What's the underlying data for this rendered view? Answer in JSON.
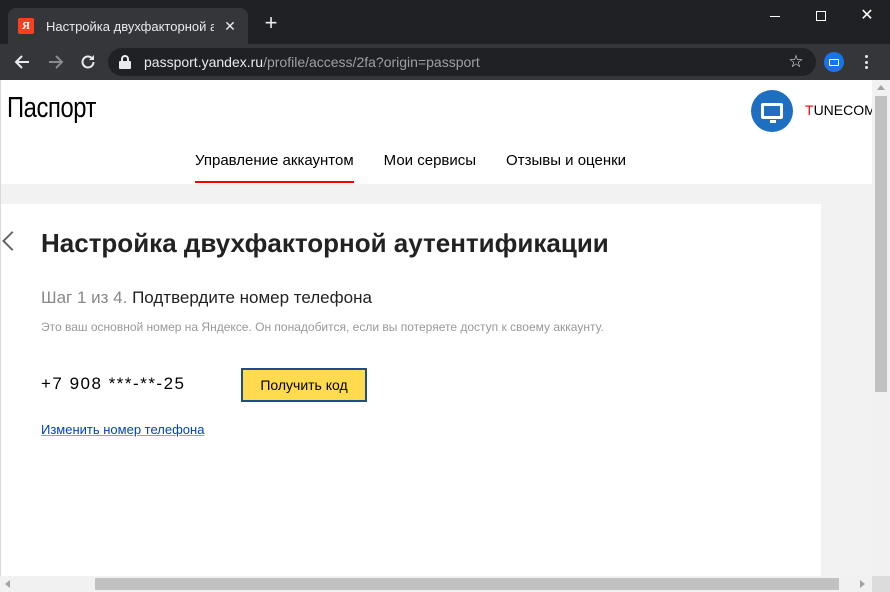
{
  "browser": {
    "tab_title": "Настройка двухфакторной аутентификации",
    "favicon_letter": "Я",
    "tab_close": "✕",
    "new_tab": "+",
    "url_host": "passport.yandex.ru",
    "url_path": "/profile/access/2fa?origin=passport",
    "colors": {
      "frame": "#202124",
      "toolbar": "#35363a"
    }
  },
  "header": {
    "logo": "Паспорт",
    "user_first_letter": "T",
    "user_rest": "UNECOM",
    "tabs": [
      {
        "label": "Управление аккаунтом",
        "active": true
      },
      {
        "label": "Мои сервисы",
        "active": false
      },
      {
        "label": "Отзывы и оценки",
        "active": false
      }
    ],
    "colors": {
      "accent": "#ff0000",
      "avatar": "#1e6fc1"
    }
  },
  "main": {
    "title": "Настройка двухфакторной аутентификации",
    "step_number": "Шаг 1 из 4.",
    "step_text": "Подтвердите номер телефона",
    "hint": "Это ваш основной номер на Яндексе. Он понадобится, если вы потеряете доступ к своему аккаунту.",
    "phone": "+7 908 ***-**-25",
    "get_code_label": "Получить код",
    "change_phone_label": "Изменить номер телефона",
    "colors": {
      "button": "#ffdb4d",
      "link": "#0044bb"
    }
  }
}
